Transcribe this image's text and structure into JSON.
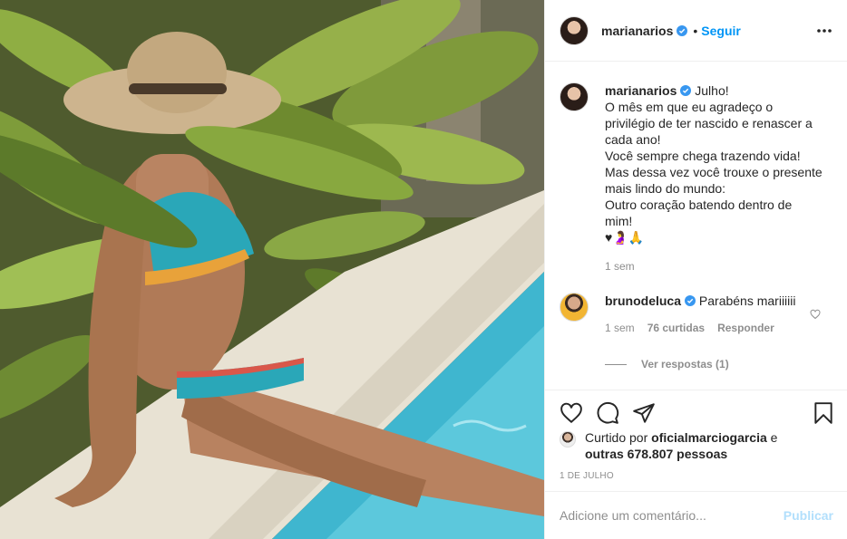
{
  "post": {
    "username": "marianarios",
    "follow_label": "Seguir",
    "separator": "•"
  },
  "caption": {
    "username": "marianarios",
    "lines": [
      "Julho!",
      "O mês em que eu agradeço o",
      "privilégio de ter nascido e renascer a",
      "cada ano!",
      "Você sempre chega trazendo vida!",
      "Mas dessa vez você trouxe o presente",
      "mais lindo do mundo:",
      "Outro coração batendo dentro de",
      "mim!",
      "♥🤰🙏"
    ],
    "time": "1 sem"
  },
  "comment": {
    "username": "brunodeluca",
    "text": "Parabéns mariiiiii",
    "time": "1 sem",
    "likes": "76 curtidas",
    "reply_label": "Responder",
    "view_replies": "Ver respostas (1)"
  },
  "likes": {
    "prefix": "Curtido por",
    "user": "oficialmarciogarcia",
    "conj": "e",
    "others": "outras 678.807 pessoas"
  },
  "date": "1 DE JULHO",
  "add_comment": {
    "placeholder": "Adicione um comentário...",
    "publish_label": "Publicar"
  },
  "colors": {
    "link_blue": "#0095f6",
    "publish_disabled": "#b2dffc",
    "verified": "#3897f0",
    "muted": "#8e8e8e"
  },
  "icons": [
    "verified-badge-icon",
    "more-options-icon",
    "heart-icon",
    "comment-icon",
    "share-icon",
    "bookmark-icon",
    "small-heart-icon"
  ]
}
